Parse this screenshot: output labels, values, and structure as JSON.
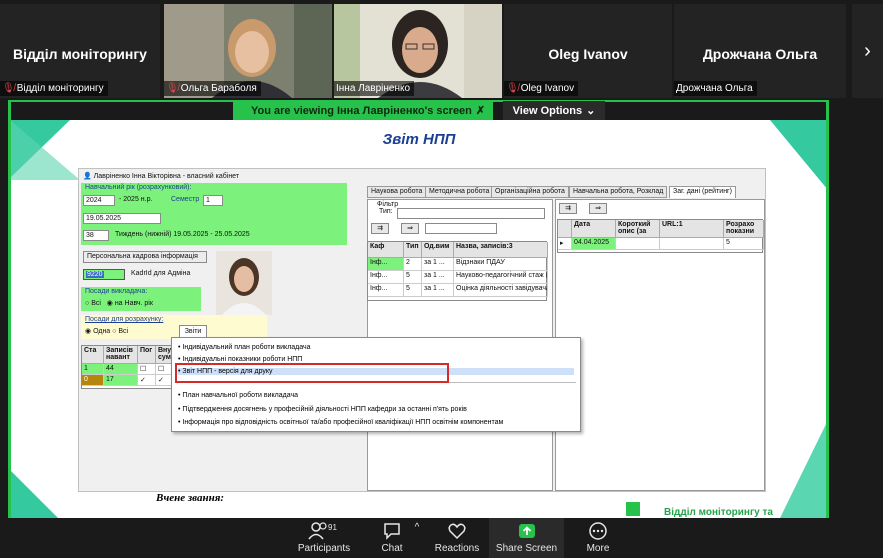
{
  "participants": [
    {
      "big_name": "Відділ моніторингу",
      "tag": "Відділ моніторингу",
      "muted": true,
      "video": false
    },
    {
      "big_name": "",
      "tag": "Ольга Бараболя",
      "muted": true,
      "video": true
    },
    {
      "big_name": "",
      "tag": "Інна Лавріненко",
      "muted": false,
      "video": true,
      "active": true
    },
    {
      "big_name": "Oleg Ivanov",
      "tag": "Oleg Ivanov",
      "muted": true,
      "video": false
    },
    {
      "big_name": "Дрожчана Ольга",
      "tag": "Дрожчана Ольга",
      "muted": false,
      "video": false
    }
  ],
  "next_icon": "chevron-right-icon",
  "banner": {
    "text": "You are viewing  Інна Лавріненко's screen",
    "view_options": "View Options"
  },
  "slide": {
    "title": "Звіт НПП",
    "footer_text": "Вчене звання:",
    "logo_text": "Відділ моніторингу та"
  },
  "app": {
    "cabinet_title": "Лавріненко Інна Вікторівна - власний кабінет",
    "year_label": "Навчальний рік (розрахунковий):",
    "year_value": "2024",
    "year_suffix": "- 2025 н.р.",
    "semester_label": "Семестр",
    "semester_value": "1",
    "date_value": "19.05.2025",
    "week_value": "38",
    "week_text": "Тиждень (нижній) 19.05.2025 - 25.05.2025",
    "hr_button": "Персональна кадрова інформація",
    "kadr_value": "9220",
    "kadr_label": "KadrId для Адміна",
    "positions_label": "Посади викладача:",
    "pos_all": "Всі",
    "pos_current": "на Навч. рік",
    "calc_label": "Посади для розрахунку:",
    "calc_one": "Одна",
    "calc_all": "Всі",
    "reports_tab": "Звіти",
    "left_grid": {
      "headers": [
        "Ста",
        "Записів навант",
        "Пог",
        "Вну сум"
      ],
      "rows": [
        [
          "1",
          "44",
          "",
          ""
        ],
        [
          "0",
          "17",
          "✓",
          "✓"
        ]
      ]
    },
    "tabs": [
      "Наукова робота",
      "Методична робота",
      "Організаційна робота",
      "Навчальна робота, Розклад",
      "Заг. дані (рейтинг)"
    ],
    "filter_label": "Фільтр",
    "type_label": "Тип:",
    "mid_grid": {
      "headers": [
        "Каф",
        "Тип",
        "Од.вим",
        "Назва, записів:3"
      ],
      "rows": [
        [
          "Інф...",
          "2",
          "за 1 ...",
          "Відзнаки ПДАУ"
        ],
        [
          "Інф...",
          "5",
          "за 1 ...",
          "Науково-педагогічний стаж (з"
        ],
        [
          "Інф...",
          "5",
          "за 1 ...",
          "Оцінка діяльності завідувача"
        ]
      ]
    },
    "right_grid": {
      "headers": [
        "Дата",
        "Короткий опис (за",
        "URL:1",
        "Розрахо показни"
      ],
      "rows": [
        [
          "04.04.2025",
          "",
          "",
          "5"
        ]
      ]
    },
    "menu": [
      "Індивідуальний план роботи викладача",
      "Індивідуальні показники роботи НПП",
      "Звіт НПП - версія для друку",
      "План навчальної роботи викладача",
      "Підтвердження досягнень у професійній діяльності НПП кафедри за останні п'ять років",
      "Інформація про відповідність освітньої та/або професійної кваліфікації НПП  освітнім компонентам"
    ]
  },
  "toolbar": {
    "participants_count": "91",
    "items": [
      "Participants",
      "Chat",
      "Reactions",
      "Share Screen",
      "More"
    ]
  },
  "colors": {
    "accent_green": "#27c24c",
    "highlight_red": "#d62a2a",
    "title_blue": "#1c3f91"
  }
}
